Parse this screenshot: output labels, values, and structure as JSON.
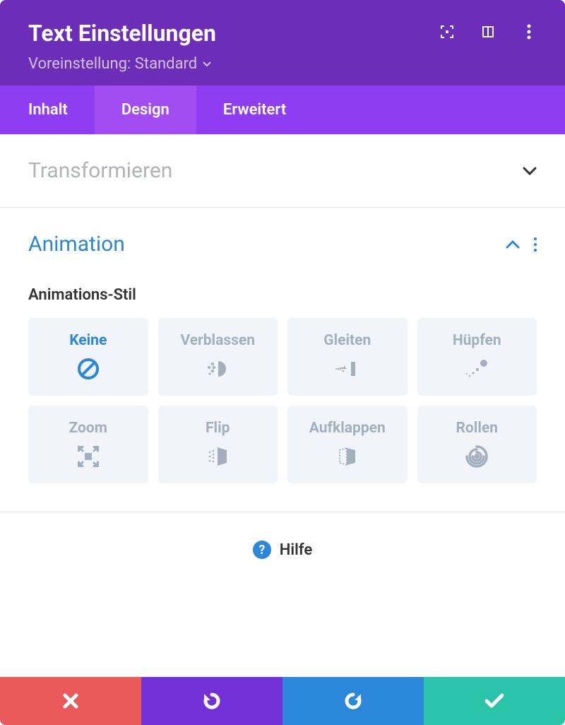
{
  "header": {
    "title": "Text Einstellungen",
    "preset": "Voreinstellung: Standard"
  },
  "tabs": {
    "content": "Inhalt",
    "design": "Design",
    "advanced": "Erweitert"
  },
  "sections": {
    "transform": "Transformieren",
    "animation": "Animation"
  },
  "animation": {
    "style_label": "Animations-Stil",
    "options": {
      "none": "Keine",
      "fade": "Verblassen",
      "slide": "Gleiten",
      "bounce": "Hüpfen",
      "zoom": "Zoom",
      "flip": "Flip",
      "fold": "Aufklappen",
      "roll": "Rollen"
    }
  },
  "help": "Hilfe"
}
